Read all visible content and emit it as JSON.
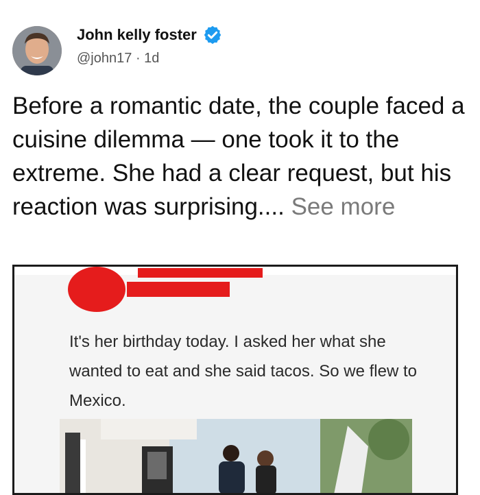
{
  "author": {
    "name": "John kelly foster",
    "handle": "@john17",
    "separator": "·",
    "age": "1d",
    "verified_icon": "verified-badge-icon",
    "accent": "#1d9bf0"
  },
  "post": {
    "text": "Before a romantic date, the couple faced a cuisine dilemma — one took it to the extreme. She had a clear request, but his reaction was surprising.... ",
    "see_more": "See more"
  },
  "embed": {
    "redaction_color": "#e51c1c",
    "quoted_text": "It's her birthday today. I asked her what she wanted to eat and she said tacos. So we flew to Mexico."
  }
}
